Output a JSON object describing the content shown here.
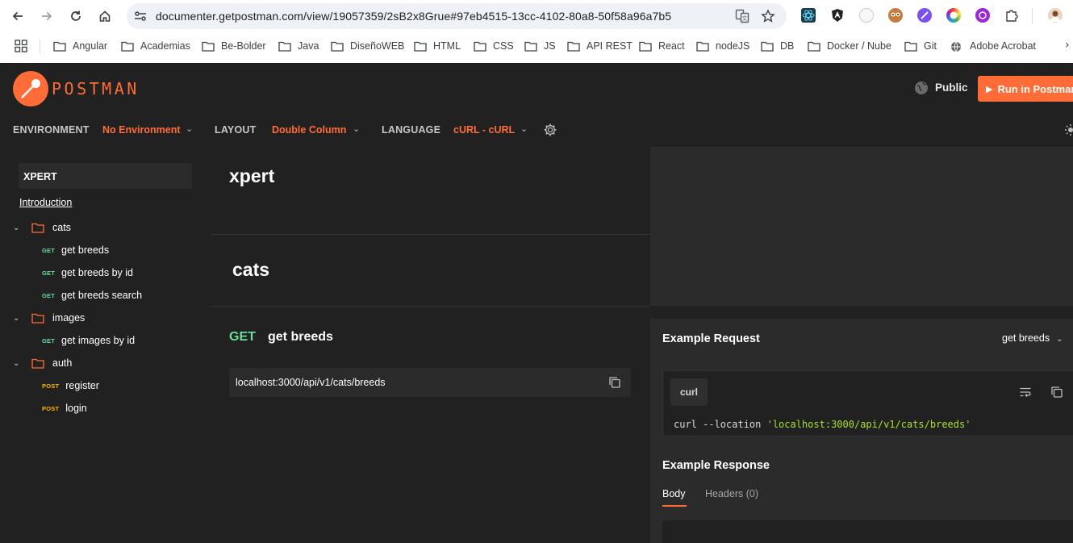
{
  "browser": {
    "url": "documenter.getpostman.com/view/19057359/2sB2x8Grue#97eb4515-13cc-4102-80a8-50f58a96a7b5",
    "nav_icons": [
      "back-arrow-icon",
      "forward-arrow-icon",
      "reload-icon",
      "home-icon"
    ],
    "bookmarks": [
      "Angular",
      "Academias",
      "Be-Bolder",
      "Java",
      "DiseñoWEB",
      "HTML",
      "CSS",
      "JS",
      "API REST",
      "React",
      "nodeJS",
      "DB",
      "Docker / Nube",
      "Git",
      "Adobe Acrobat"
    ],
    "more_glyph": "›"
  },
  "postman": {
    "brand": "POSTMAN",
    "brand_color": "#ff6c37",
    "visibility": "Public",
    "run_button": "Run in Postman"
  },
  "toolbar": {
    "environment_label": "ENVIRONMENT",
    "environment_value": "No Environment",
    "layout_label": "LAYOUT",
    "layout_value": "Double Column",
    "language_label": "LANGUAGE",
    "language_value": "cURL - cURL"
  },
  "sidebar": {
    "title": "XPERT",
    "introduction": "Introduction",
    "folders": [
      {
        "name": "cats",
        "requests": [
          {
            "method": "GET",
            "name": "get breeds"
          },
          {
            "method": "GET",
            "name": "get breeds by id"
          },
          {
            "method": "GET",
            "name": "get breeds search"
          }
        ]
      },
      {
        "name": "images",
        "requests": [
          {
            "method": "GET",
            "name": "get images by id"
          }
        ]
      },
      {
        "name": "auth",
        "requests": [
          {
            "method": "POST",
            "name": "register"
          },
          {
            "method": "POST",
            "name": "login"
          }
        ]
      }
    ]
  },
  "main": {
    "collection_title": "xpert",
    "folder_title": "cats",
    "request_method": "GET",
    "request_name": "get breeds",
    "request_url": "localhost:3000/api/v1/cats/breeds"
  },
  "example": {
    "request_title": "Example Request",
    "request_select": "get breeds",
    "language_tab": "curl",
    "code_prefix": "curl --location ",
    "code_string": "'localhost:3000/api/v1/cats/breeds'",
    "response_title": "Example Response",
    "tab_body": "Body",
    "tab_headers": "Headers (0)"
  },
  "colors": {
    "get": "#6bdd9a",
    "post": "#ffb400",
    "accent": "#ff6c37",
    "background": "#212121",
    "panel": "#2b2b2b"
  }
}
